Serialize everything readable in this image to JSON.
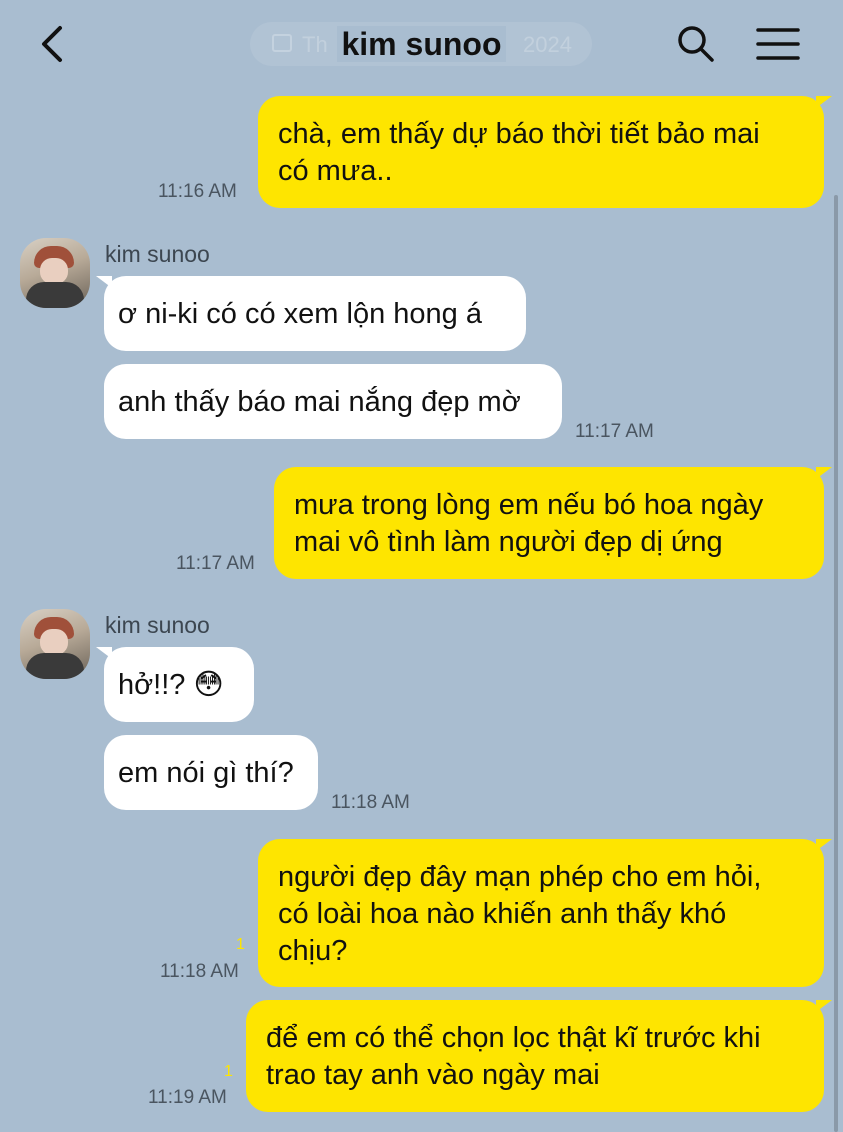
{
  "header": {
    "title": "kim sunoo",
    "date_hint": "Th",
    "year_hint": "2024"
  },
  "messages": [
    {
      "type": "sent",
      "lines": [
        "chà, em thấy dự báo thời tiết bảo mai",
        "có mưa.."
      ],
      "time": "11:16 AM"
    },
    {
      "type": "recv",
      "sender": "kim sunoo",
      "lines": [
        "ơ ni-ki có có xem lộn hong á"
      ]
    },
    {
      "type": "recv",
      "lines": [
        "anh thấy báo mai nắng đẹp mờ"
      ],
      "time": "11:17 AM"
    },
    {
      "type": "sent",
      "lines": [
        "mưa trong lòng em nếu bó hoa ngày",
        "mai vô tình làm người đẹp dị ứng"
      ],
      "time": "11:17 AM"
    },
    {
      "type": "recv",
      "sender": "kim sunoo",
      "lines": [
        "hở!!? 😳"
      ]
    },
    {
      "type": "recv",
      "lines": [
        "em nói gì thí?"
      ],
      "time": "11:18 AM"
    },
    {
      "type": "sent",
      "lines": [
        "người đẹp đây mạn phép cho em hỏi,",
        "có loài hoa nào khiến anh thấy khó",
        "chịu?"
      ],
      "time": "11:18 AM",
      "unread": "1"
    },
    {
      "type": "sent",
      "lines": [
        "để em có thể chọn lọc thật kĩ trước khi",
        "trao tay anh vào ngày mai"
      ],
      "time": "11:19 AM",
      "unread": "1"
    }
  ],
  "colors": {
    "background": "#a9bdd0",
    "sent_bubble": "#fee500",
    "recv_bubble": "#ffffff"
  }
}
